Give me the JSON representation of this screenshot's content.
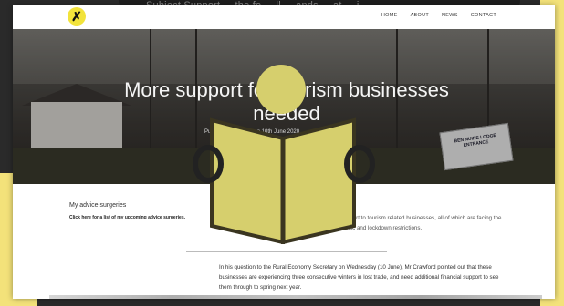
{
  "top_ghost_text": "Subject Support ... the fo ... ll ... ands ... at ... i",
  "site": {
    "logo_glyph": "✗",
    "nav": [
      "HOME",
      "ABOUT",
      "NEWS",
      "CONTACT"
    ]
  },
  "hero": {
    "title": "More support for tourism businesses needed",
    "meta": "Published by Lee ... on 10th June 2020",
    "sign_lines": [
      "BEN NUIRE LODGE",
      "ENTRANCE"
    ]
  },
  "sidebar": {
    "title": "My advice surgeries",
    "link": "Click here for a list of my upcoming advice surgeries."
  },
  "article": {
    "p1": "Angus MSP Bruce Crawford has called for more support to tourism related businesses, all of which are facing the most severe trading period as a result of the pandemic and lockdown restrictions.",
    "p2": "In his question to the Rural Economy Secretary on Wednesday (10 June), Mr Crawford pointed out that these businesses are experiencing three consecutive winters in lost trade, and need additional financial support to see them through to spring next year."
  },
  "overlay_icon": "reader-icon",
  "colors": {
    "accent_yellow": "#f3e27a",
    "logo_yellow": "#f2e33b",
    "reader_icon_fill": "#d6cf6d"
  }
}
